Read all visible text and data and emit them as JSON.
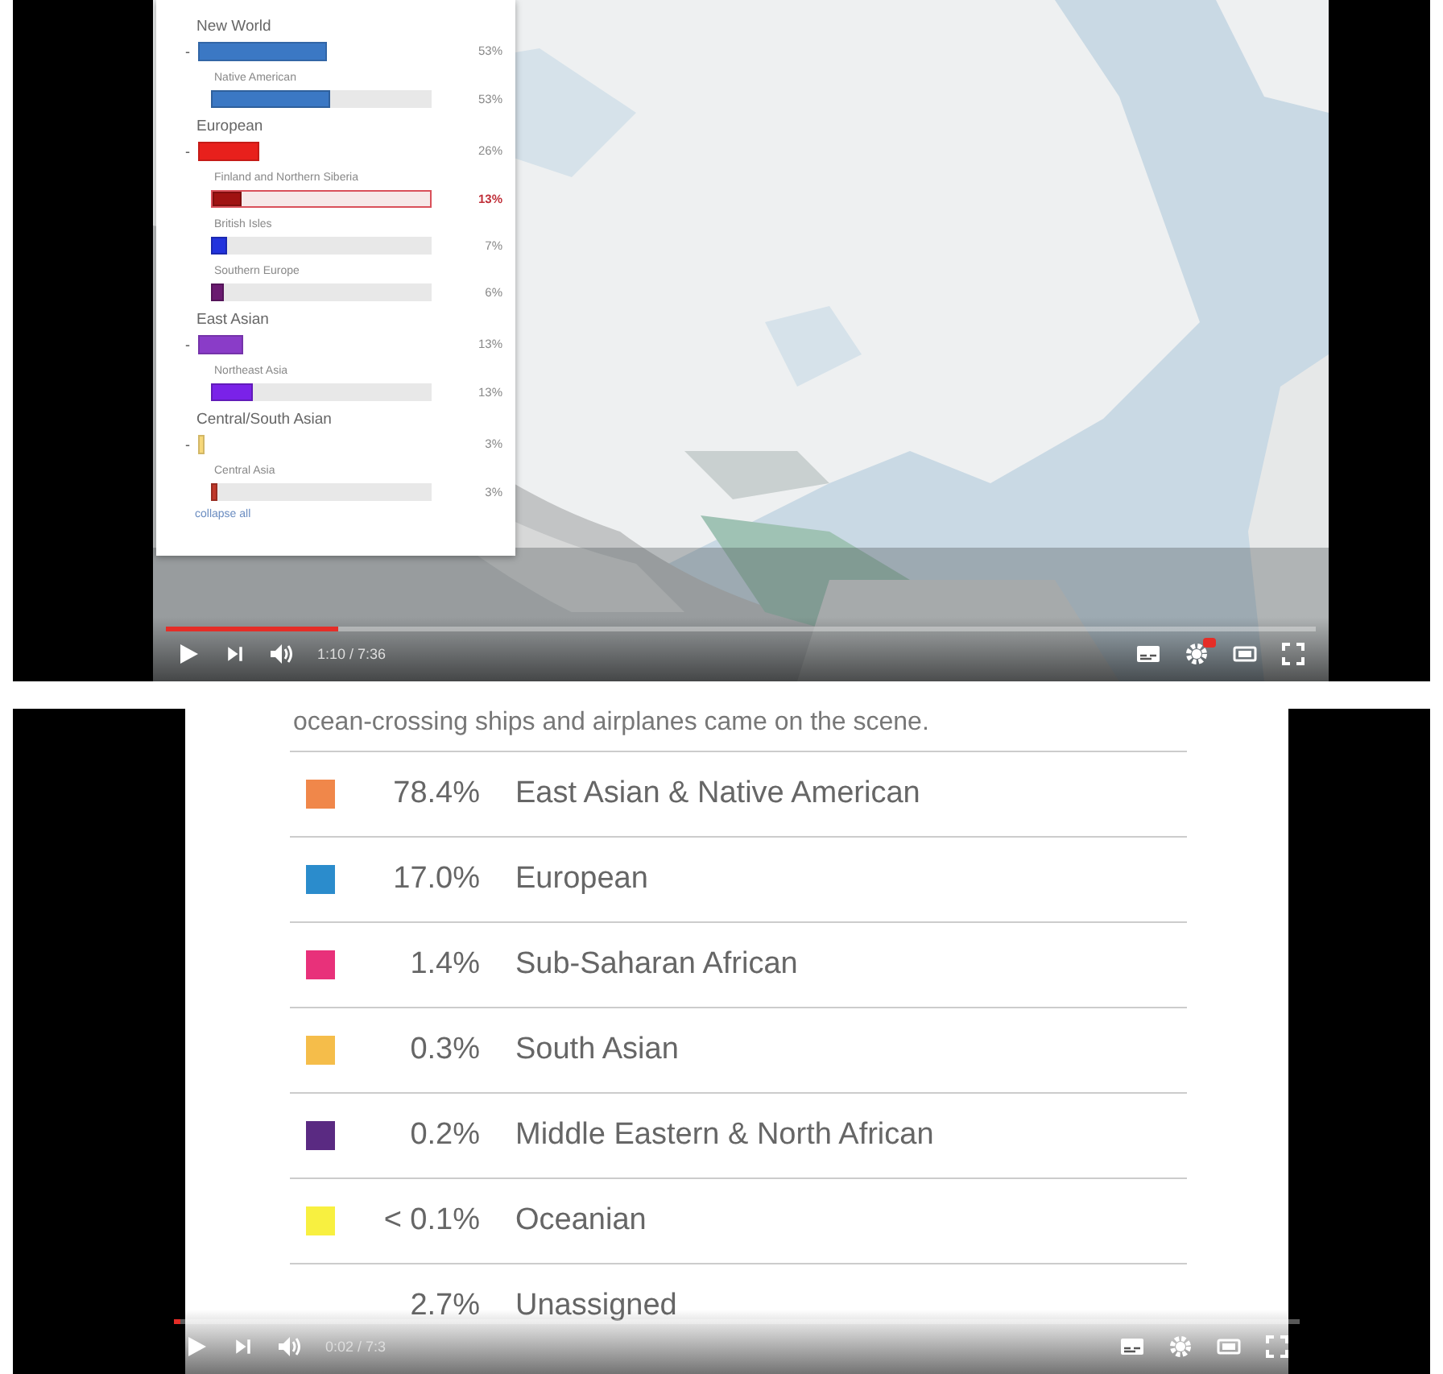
{
  "top_player": {
    "panel": {
      "groups": [
        {
          "label": "New World",
          "toggle": "-",
          "color": "#3b78c4",
          "percent": "53%",
          "children": [
            {
              "label": "Native American",
              "color": "#3b78c4",
              "level": 0.54,
              "percent": "53%",
              "selected": false
            }
          ]
        },
        {
          "label": "European",
          "toggle": "-",
          "color": "#e8201c",
          "percent": "26%",
          "children": [
            {
              "label": "Finland and Northern Siberia",
              "color": "#a01212",
              "level": 0.13,
              "percent": "13%",
              "selected": true
            },
            {
              "label": "British Isles",
              "color": "#2233dd",
              "level": 0.07,
              "percent": "7%",
              "selected": false
            },
            {
              "label": "Southern Europe",
              "color": "#6a1a70",
              "level": 0.06,
              "percent": "6%",
              "selected": false
            }
          ]
        },
        {
          "label": "East Asian",
          "toggle": "-",
          "color": "#8a3cc8",
          "percent": "13%",
          "children": [
            {
              "label": "Northeast Asia",
              "color": "#7a22e8",
              "level": 0.19,
              "percent": "13%",
              "selected": false
            }
          ]
        },
        {
          "label": "Central/South Asian",
          "toggle": "-",
          "color": "#f7d87a",
          "percent": "3%",
          "children": [
            {
              "label": "Central Asia",
              "color": "#c0392b",
              "level": 0.03,
              "percent": "3%",
              "selected": false
            }
          ]
        }
      ],
      "link": "collapse all"
    },
    "controls": {
      "level": 0.15,
      "time": "1:10 / 7:36",
      "hd_badge": true
    }
  },
  "bottom_player": {
    "intro": "ocean-crossing ships and airplanes came on the scene.",
    "rows": [
      {
        "percent": "78.4%",
        "label": "East Asian & Native American",
        "color": "#f0874a"
      },
      {
        "percent": "17.0%",
        "label": "European",
        "color": "#2b8ccc"
      },
      {
        "percent": "1.4%",
        "label": "Sub-Saharan African",
        "color": "#e8317a"
      },
      {
        "percent": "0.3%",
        "label": "South Asian",
        "color": "#f5bd4a"
      },
      {
        "percent": "0.2%",
        "label": "Middle Eastern & North African",
        "color": "#5a2a82"
      },
      {
        "percent": "< 0.1%",
        "label": "Oceanian",
        "color": "#f8f040"
      },
      {
        "percent": "2.7%",
        "label": "Unassigned"
      }
    ],
    "controls": {
      "level": 0.006,
      "time": "0:02 / 7:3"
    }
  }
}
